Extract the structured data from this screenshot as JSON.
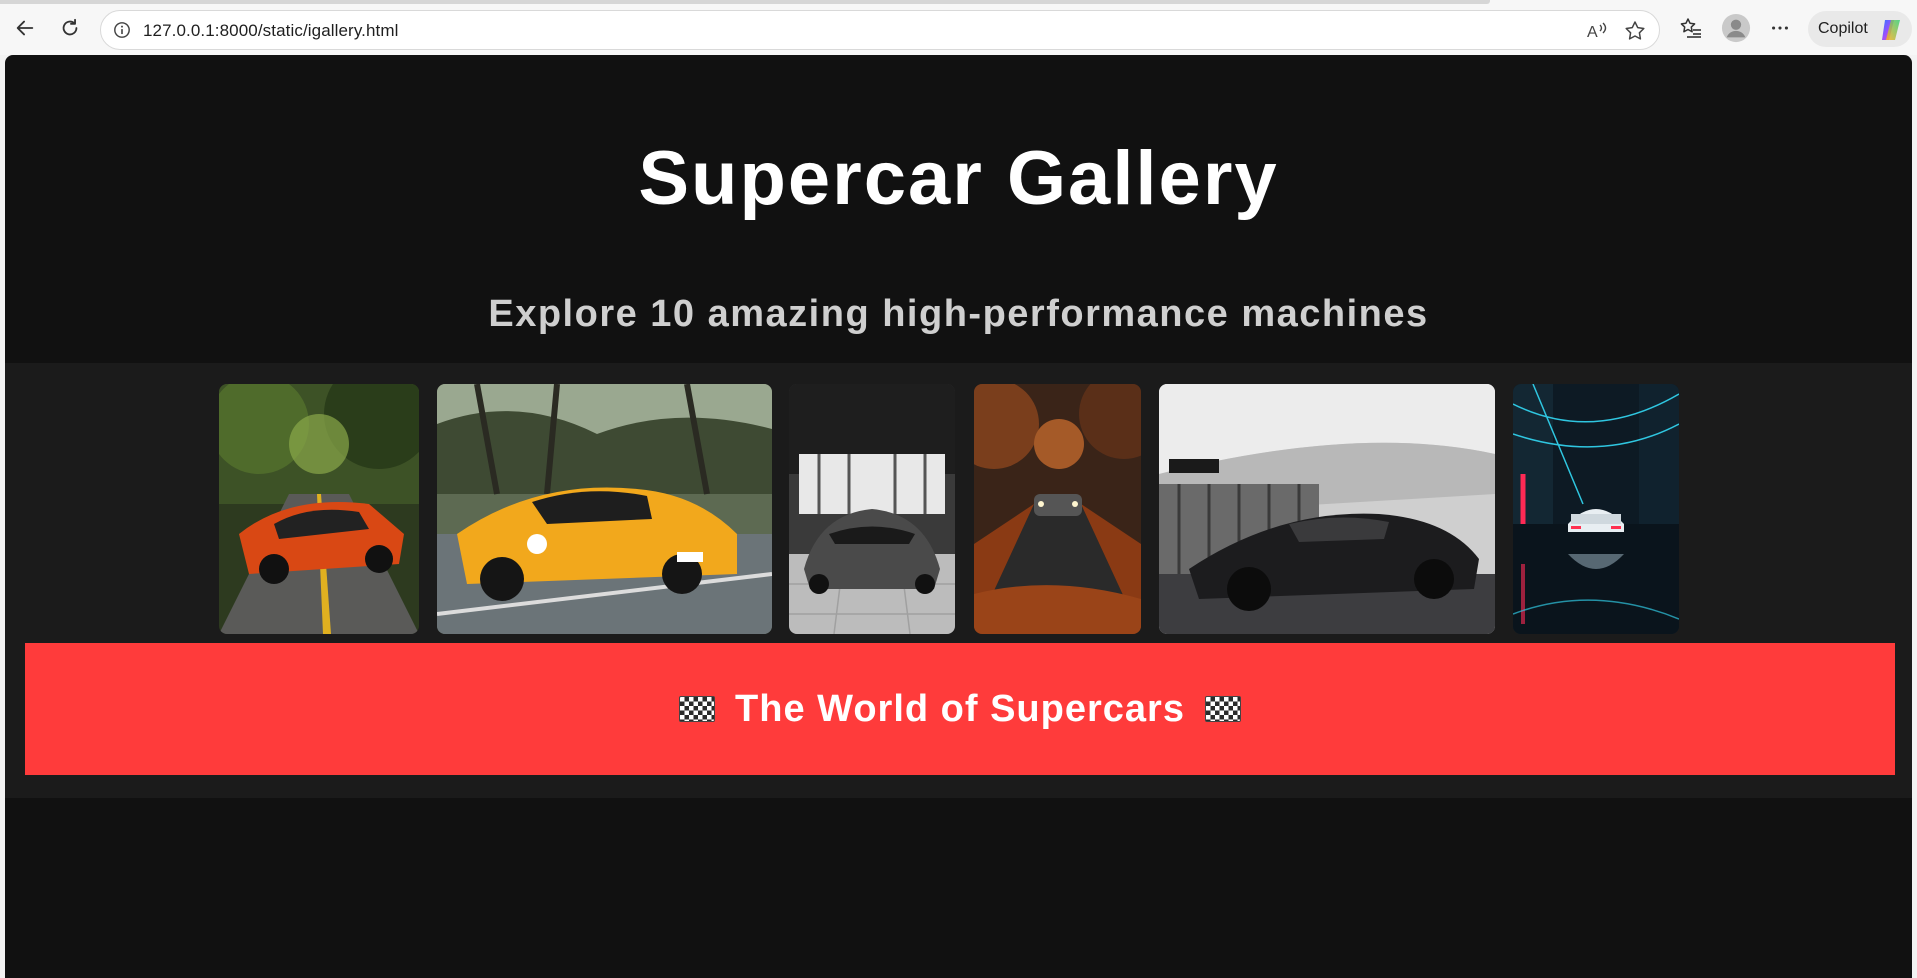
{
  "browser": {
    "url": "127.0.0.1:8000/static/igallery.html",
    "copilot_label": "Copilot",
    "icons": [
      "back-icon",
      "refresh-icon",
      "info-icon",
      "read-aloud-icon",
      "favorite-star-icon",
      "favorites-list-icon",
      "profile-icon",
      "more-icon",
      "copilot-icon"
    ]
  },
  "page": {
    "title": "Supercar Gallery",
    "subtitle": "Explore 10 amazing high-performance machines",
    "banner": {
      "text": "The World of Supercars",
      "color": "#ff3b3b"
    },
    "background": "#111111"
  },
  "gallery": {
    "items": [
      {
        "subject": "orange muscle car on a forest road"
      },
      {
        "subject": "yellow supercar driving on a tree-lined road"
      },
      {
        "subject": "grey supercar in a showroom"
      },
      {
        "subject": "car on an autumn leaf-covered road"
      },
      {
        "subject": "black supercar near a stadium"
      },
      {
        "subject": "white car in a neon-lit alley"
      }
    ]
  }
}
